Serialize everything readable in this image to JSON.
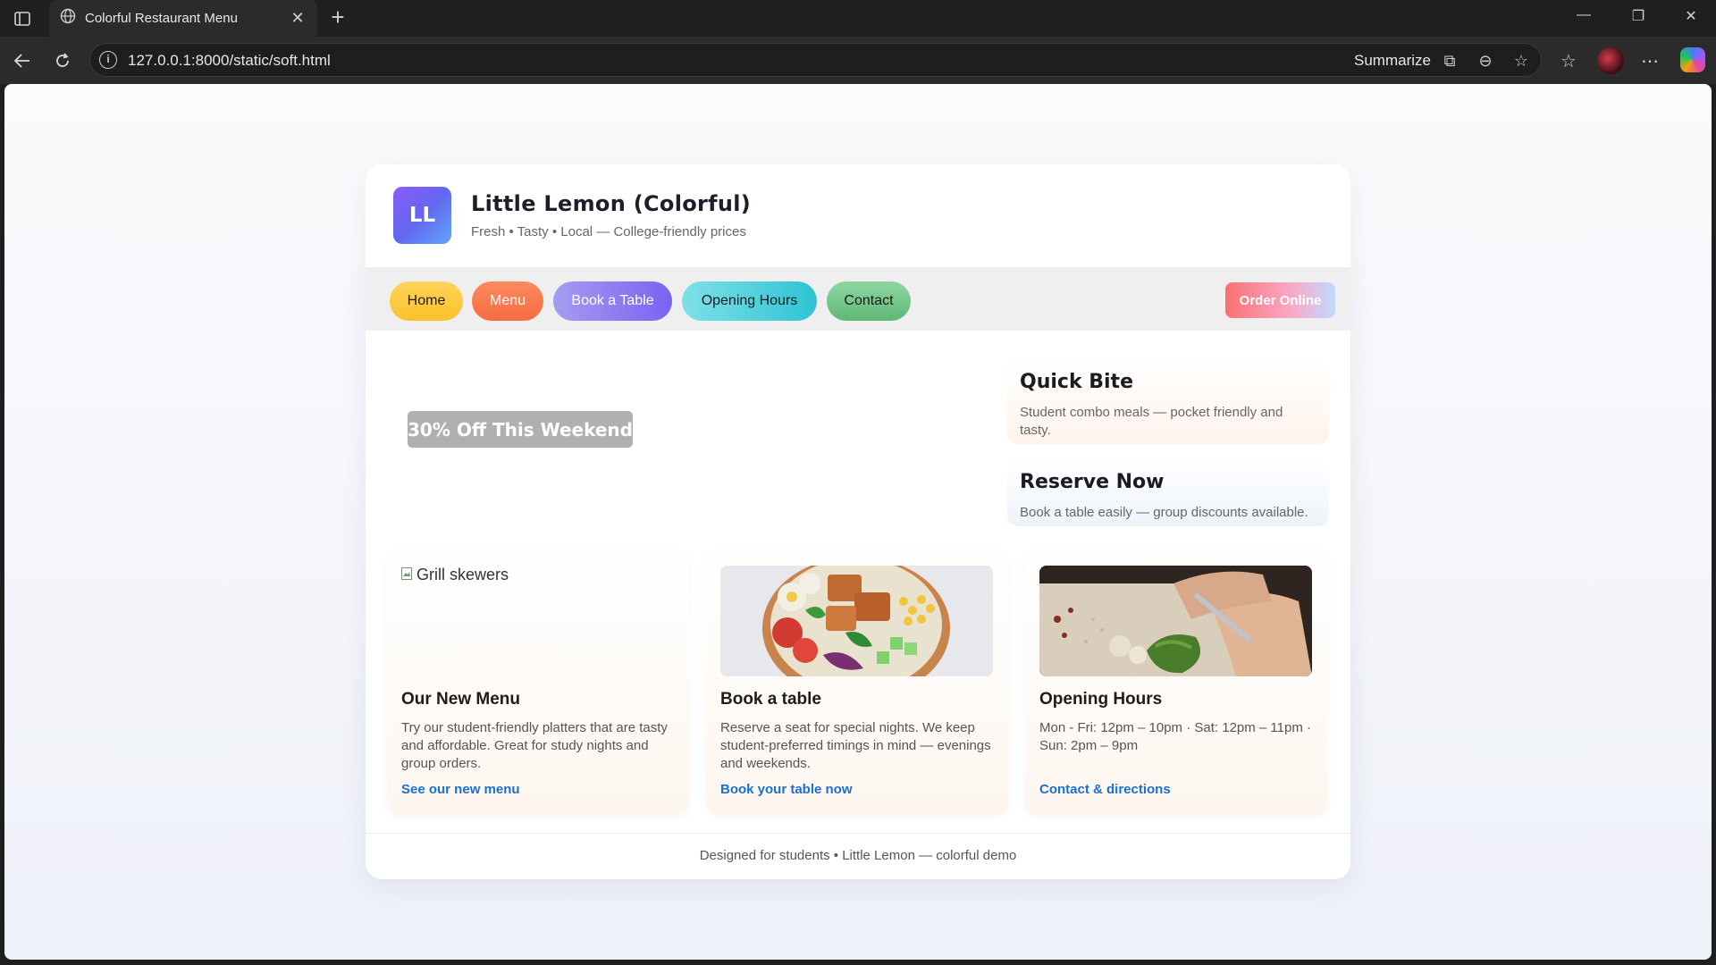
{
  "browser": {
    "tab_title": "Colorful Restaurant Menu",
    "url": "127.0.0.1:8000/static/soft.html",
    "summarize_label": "Summarize"
  },
  "header": {
    "logo_text": "LL",
    "title": "Little Lemon (Colorful)",
    "subtitle": "Fresh • Tasty • Local — College-friendly prices"
  },
  "nav": {
    "items": [
      {
        "label": "Home",
        "color": "#fcc93a"
      },
      {
        "label": "Menu",
        "color": "#fb7a4f"
      },
      {
        "label": "Book a Table",
        "color": "#8f86f0"
      },
      {
        "label": "Opening Hours",
        "color": "#4fd2dc"
      },
      {
        "label": "Contact",
        "color": "#76c98c"
      }
    ],
    "order_label": "Order Online"
  },
  "promo": {
    "label": "30% Off This Weekend"
  },
  "side": {
    "quick": {
      "title": "Quick Bite",
      "text": "Student combo meals — pocket friendly and tasty."
    },
    "reserve": {
      "title": "Reserve Now",
      "text": "Book a table easily — group discounts available."
    }
  },
  "features": [
    {
      "alt": "Grill skewers",
      "title": "Our New Menu",
      "text": "Try our student-friendly platters that are tasty and affordable. Great for study nights and group orders.",
      "link": "See our new menu"
    },
    {
      "title": "Book a table",
      "text": "Reserve a seat for special nights. We keep student-preferred timings in mind — evenings and weekends.",
      "link": "Book your table now"
    },
    {
      "title": "Opening Hours",
      "text": "Mon - Fri: 12pm – 10pm · Sat: 12pm – 11pm · Sun: 2pm – 9pm",
      "link": "Contact & directions"
    }
  ],
  "footer": {
    "text": "Designed for students • Little Lemon — colorful demo"
  },
  "colors": {
    "accent_link": "#1d6fd1",
    "logo_gradient_start": "#8b5cf6",
    "logo_gradient_end": "#60a5fa"
  }
}
